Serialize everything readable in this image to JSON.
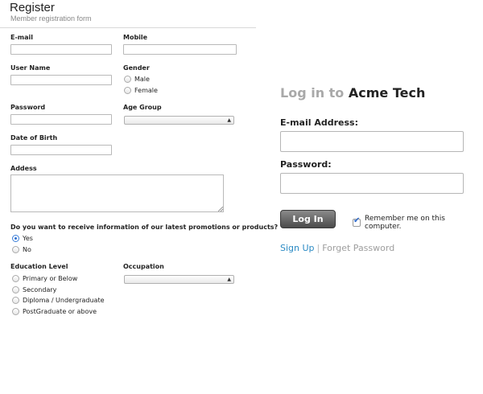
{
  "register": {
    "title": "Register",
    "subtitle": "Member registration form",
    "email_label": "E-mail",
    "mobile_label": "Mobile",
    "username_label": "User Name",
    "gender_label": "Gender",
    "gender_options": [
      "Male",
      "Female"
    ],
    "password_label": "Password",
    "age_group_label": "Age Group",
    "dob_label": "Date of Birth",
    "address_label": "Addess",
    "promo_question": "Do you want to receive information of our latest promotions or products?",
    "promo_options": [
      "Yes",
      "No"
    ],
    "promo_selected": "Yes",
    "education_label": "Education Level",
    "education_options": [
      "Primary or Below",
      "Secondary",
      "Diploma / Undergraduate",
      "PostGraduate or above"
    ],
    "occupation_label": "Occupation"
  },
  "login": {
    "title_prefix": "Log in to",
    "brand": "Acme Tech",
    "email_label": "E-mail Address:",
    "password_label": "Password:",
    "login_button": "Log In",
    "remember_label": "Remember me on this computer.",
    "remember_checked": true,
    "signup_link": "Sign Up",
    "separator": "|",
    "forgot_link": "Forget Password"
  },
  "colors": {
    "link_blue": "#2a8ac4",
    "muted_gray": "#a9a9a9",
    "button_dark": "#4a4a4a"
  },
  "icons": {
    "select_arrow": "select-arrow-icon",
    "checkmark": "checkmark-icon",
    "resize": "resize-grip-icon"
  }
}
